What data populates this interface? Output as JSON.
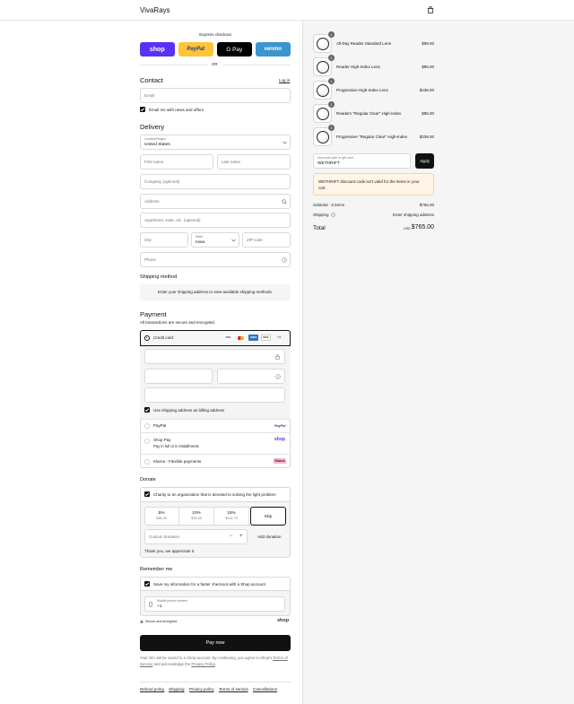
{
  "header": {
    "store_name": "VivaRays",
    "cart_icon": "shopping-bag-icon"
  },
  "express": {
    "title": "Express checkout",
    "shop_label": "shop",
    "paypal_label": "PayPal",
    "gpay_label": "G Pay",
    "venmo_label": "venmo",
    "or_label": "OR"
  },
  "contact": {
    "title": "Contact",
    "login_label": "Log in",
    "email_placeholder": "Email",
    "news_label": "Email me with news and offers"
  },
  "delivery": {
    "title": "Delivery",
    "country_label": "Country/Region",
    "country_value": "United States",
    "first_name_placeholder": "First name",
    "last_name_placeholder": "Last name",
    "company_placeholder": "Company (optional)",
    "address_placeholder": "Address",
    "apartment_placeholder": "Apartment, suite, etc. (optional)",
    "city_placeholder": "City",
    "state_label": "State",
    "state_value": "Iowa",
    "zip_placeholder": "ZIP code",
    "phone_placeholder": "Phone"
  },
  "shipping_method": {
    "title": "Shipping method",
    "message": "Enter your shipping address to view available shipping methods."
  },
  "payment": {
    "title": "Payment",
    "subtitle": "All transactions are secure and encrypted.",
    "credit_card_label": "Credit card",
    "card_more": "+4",
    "billing_label": "Use shipping address as billing address",
    "paypal_label": "PayPal",
    "paypal_logo": "PayPal",
    "shoppay_label": "Shop Pay",
    "shoppay_sub": "Pay in full or in installments",
    "shoppay_logo": "shop",
    "klarna_label": "Klarna - Flexible payments",
    "klarna_logo": "Klarna"
  },
  "donate": {
    "title": "Donate",
    "checkbox_label": "Charity to an organization that is devoted to solving the light problem",
    "options": [
      {
        "pct": "5%",
        "amount": "$38.25"
      },
      {
        "pct": "10%",
        "amount": "$76.50"
      },
      {
        "pct": "15%",
        "amount": "$114.75"
      }
    ],
    "skip_label": "Skip",
    "custom_placeholder": "Custom donation",
    "add_label": "Add donation",
    "thanks": "Thank you, we appreciate it."
  },
  "remember": {
    "title": "Remember me",
    "save_label": "Save my information for a faster checkout with a Shop account",
    "mobile_label": "Mobile phone number",
    "mobile_value": "+1",
    "secure_label": "Secure and encrypted",
    "shop_logo": "shop"
  },
  "pay_button": "Pay now",
  "consent": {
    "line1": "Your info will be saved to a Shop account. By continuing, you agree to Shop's",
    "tos": "Terms of Service",
    "mid": "and acknowledge the",
    "privacy": "Privacy Policy",
    "end": "."
  },
  "footer_links": [
    "Refund policy",
    "Shipping",
    "Privacy policy",
    "Terms of service",
    "Cancellations"
  ],
  "cart": {
    "items": [
      {
        "qty": "1",
        "name": "All-Day Reader Standard Lens",
        "price": "$99.00"
      },
      {
        "qty": "1",
        "name": "Reader High-Index Lens",
        "price": "$95.00"
      },
      {
        "qty": "1",
        "name": "Progressive High-Index Lens",
        "price": "$238.00"
      },
      {
        "qty": "1",
        "name": "Readers \"Regular Clear\" High-Index",
        "price": "$95.00"
      },
      {
        "qty": "1",
        "name": "Progressive \"Regular Clear\" High-Index",
        "price": "$238.00"
      }
    ],
    "discount_label": "Discount code or gift card",
    "discount_value": "WETHRIFT",
    "apply_label": "Apply",
    "warning": "WETHRIFT discount code isn't valid for the items in your cart.",
    "subtotal_label": "Subtotal · 5 items",
    "subtotal_value": "$765.00",
    "shipping_label": "Shipping",
    "shipping_value": "Enter shipping address",
    "total_label": "Total",
    "currency": "USD",
    "total_value": "$765.00"
  },
  "colors": {
    "shop": "#5a31f4",
    "paypal": "#ffc439",
    "venmo": "#3d95ce",
    "warning_bg": "#fff4e5"
  }
}
